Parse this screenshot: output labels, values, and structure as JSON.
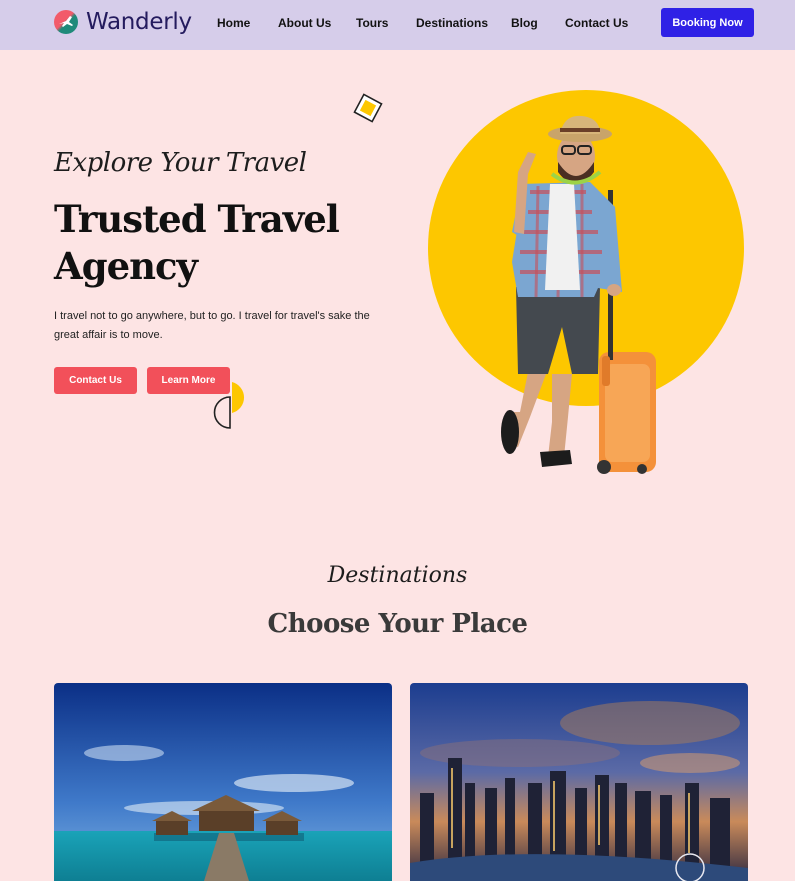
{
  "brand": {
    "name": "Wanderly"
  },
  "nav": {
    "links": [
      "Home",
      "About Us",
      "Tours",
      "Destinations",
      "Blog",
      "Contact Us"
    ],
    "cta": "Booking Now"
  },
  "hero": {
    "eyebrow": "Explore Your Travel",
    "title": "Trusted Travel Agency",
    "description": "I travel not to go anywhere, but to go. I travel for travel's sake the great affair is to move.",
    "primary_button": "Contact Us",
    "secondary_button": "Learn More"
  },
  "destinations": {
    "eyebrow": "Destinations",
    "title": "Choose Your Place",
    "cards": [
      {
        "image": "overwater-bungalow-photo"
      },
      {
        "image": "city-skyline-night-photo"
      }
    ]
  },
  "colors": {
    "page_bg": "#fde4e4",
    "nav_bg": "#d6cdea",
    "brand_text": "#241b5e",
    "booking_button": "#2f21e6",
    "hero_buttons": "#f2505a",
    "accent_circle": "#fdc700"
  },
  "icons": [
    "logo-globe-plane-icon"
  ]
}
